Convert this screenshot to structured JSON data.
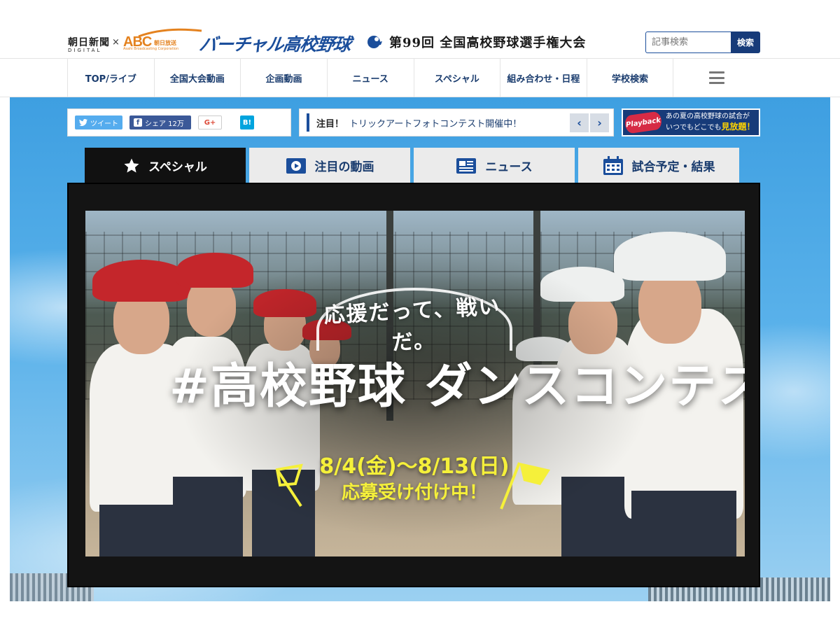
{
  "header": {
    "asahi_logo": "朝日新聞",
    "asahi_sub": "DIGITAL",
    "cross": "×",
    "abc_logo": "ABC",
    "abc_channel": "朝日放送",
    "abc_sub": "Asahi Broadcasting Corporation",
    "site_logo": "バーチャル高校野球",
    "tournament": "第99回 全国高校野球選手権大会",
    "search_placeholder": "記事検索",
    "search_button": "検索"
  },
  "nav": {
    "items": [
      {
        "label": "TOP/ライブ"
      },
      {
        "label": "全国大会動画"
      },
      {
        "label": "企画動画"
      },
      {
        "label": "ニュース"
      },
      {
        "label": "スペシャル"
      },
      {
        "label": "組み合わせ・日程"
      },
      {
        "label": "学校検索"
      }
    ],
    "menu_icon": "hamburger-icon"
  },
  "share": {
    "tweet": "ツイート",
    "facebook": "シェア 12万",
    "gplus": "G+",
    "hatena": "B!"
  },
  "notice": {
    "label": "注目！",
    "text": "トリックアートフォトコンテスト開催中！",
    "prev": "‹",
    "next": "›"
  },
  "playback": {
    "logo": "Playback",
    "line1": "あの夏の高校野球の試合が",
    "line2_prefix": "いつでもどこでも",
    "line2_highlight": "見放題！"
  },
  "tabs": [
    {
      "label": "スペシャル",
      "icon": "star-icon",
      "active": true
    },
    {
      "label": "注目の動画",
      "icon": "play-icon",
      "active": false
    },
    {
      "label": "ニュース",
      "icon": "newspaper-icon",
      "active": false
    },
    {
      "label": "試合予定・結果",
      "icon": "calendar-icon",
      "active": false
    }
  ],
  "banner": {
    "tagline": "応援だって、戦いだ。",
    "headline": "#高校野球 ダンスコンテスト",
    "dates": "8/4(金)〜8/13(日)",
    "apply": "応募受け付け中！"
  },
  "colors": {
    "brand_blue": "#1b4e9b",
    "dark_navy": "#173b79",
    "abc_orange": "#e4821f",
    "banner_yellow": "#f5f03a",
    "sky": "#3e9fe1"
  }
}
